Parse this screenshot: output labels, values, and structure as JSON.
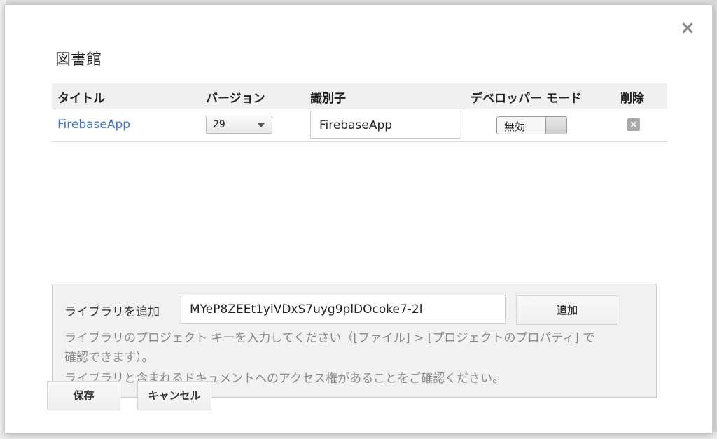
{
  "dialog": {
    "title": "図書館",
    "close_symbol": "×"
  },
  "table": {
    "headers": {
      "title": "タイトル",
      "version": "バージョン",
      "identifier": "識別子",
      "dev_mode": "デベロッパー モード",
      "delete": "削除"
    },
    "rows": [
      {
        "title": "FirebaseApp",
        "version": "29",
        "identifier": "FirebaseApp",
        "dev_mode": "無効",
        "delete_symbol": "×"
      }
    ]
  },
  "add_library": {
    "label": "ライブラリを追加",
    "key_value": "MYeP8ZEEt1ylVDxS7uyg9plDOcoke7-2l",
    "add_button": "追加",
    "hint_line1": "ライブラリのプロジェクト キーを入力してください（[ファイル] > [プロジェクトのプロパティ] で",
    "hint_line2": "確認できます）。",
    "hint_line3": "ライブラリと含まれるドキュメントへのアクセス権があることをご確認ください。"
  },
  "footer": {
    "save": "保存",
    "cancel": "キャンセル"
  },
  "icons": {
    "close": "close-icon",
    "dropdown": "chevron-down-icon",
    "delete": "delete-icon"
  }
}
